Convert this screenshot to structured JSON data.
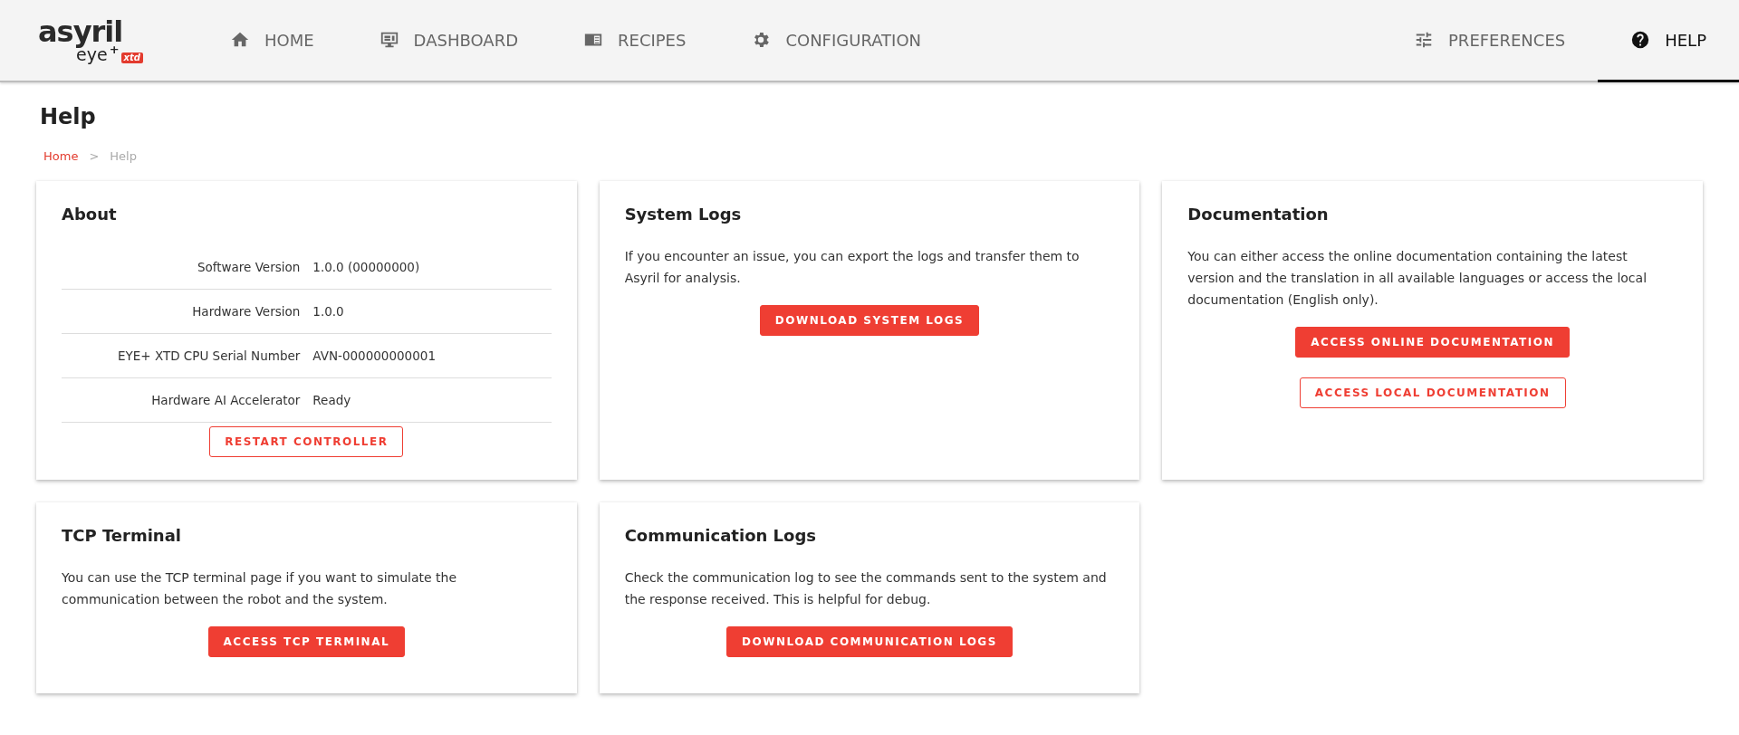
{
  "logo": {
    "brand": "asyril",
    "product": "eye",
    "sup": "+",
    "badge": "xtd"
  },
  "nav_left": [
    {
      "label": "HOME",
      "selected": false
    },
    {
      "label": "DASHBOARD",
      "selected": false
    },
    {
      "label": "RECIPES",
      "selected": false
    },
    {
      "label": "CONFIGURATION",
      "selected": false
    }
  ],
  "nav_right": [
    {
      "label": "PREFERENCES",
      "selected": false
    },
    {
      "label": "HELP",
      "selected": true
    }
  ],
  "page_title": "Help",
  "breadcrumb": {
    "link": "Home",
    "separator": ">",
    "current": "Help"
  },
  "cards": [
    {
      "kind": "table",
      "title": "About",
      "rows": [
        {
          "label": "Software Version",
          "value": "1.0.0 (00000000)"
        },
        {
          "label": "Hardware Version",
          "value": "1.0.0"
        },
        {
          "label": "EYE+ XTD CPU Serial Number",
          "value": "AVN-000000000001"
        },
        {
          "label": "Hardware AI Accelerator",
          "value": "Ready"
        }
      ],
      "buttons": [
        {
          "label": "RESTART CONTROLLER",
          "kind": "outlined"
        }
      ]
    },
    {
      "kind": "text",
      "title": "System Logs",
      "text": "If you encounter an issue, you can export the logs and transfer them to Asyril for analysis.",
      "buttons": [
        {
          "label": "DOWNLOAD SYSTEM LOGS",
          "kind": "filled"
        }
      ]
    },
    {
      "kind": "text",
      "title": "Documentation",
      "text": "You can either access the online documentation containing the latest version and the translation in all available languages or access the local documentation (English only).",
      "buttons": [
        {
          "label": "ACCESS ONLINE DOCUMENTATION",
          "kind": "filled"
        },
        {
          "label": "ACCESS LOCAL DOCUMENTATION",
          "kind": "outlined"
        }
      ]
    },
    {
      "kind": "text",
      "title": "TCP Terminal",
      "text": "You can use the TCP terminal page if you want to simulate the communication between the robot and the system.",
      "buttons": [
        {
          "label": "ACCESS TCP TERMINAL",
          "kind": "filled"
        }
      ]
    },
    {
      "kind": "text",
      "title": "Communication Logs",
      "text": "Check the communication log to see the commands sent to the system and the response received. This is helpful for debug.",
      "buttons": [
        {
          "label": "DOWNLOAD COMMUNICATION LOGS",
          "kind": "filled"
        }
      ]
    }
  ]
}
